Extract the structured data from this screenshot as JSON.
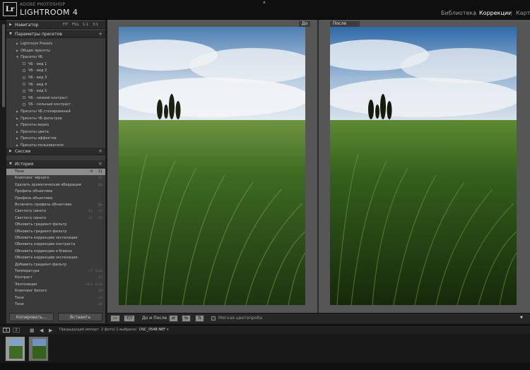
{
  "brand": {
    "logo": "Lr",
    "sub": "ADOBE PHOTOSHOP",
    "main": "LIGHTROOM 4"
  },
  "modules": [
    "Библиотека",
    "Коррекции",
    "Карта"
  ],
  "active_module": "Коррекции",
  "navigator": {
    "title": "Навигатор",
    "zoom": [
      "FIT",
      "FILL",
      "1:1",
      "3:1"
    ]
  },
  "presets": {
    "title": "Параметры пресетов",
    "items": [
      {
        "label": "Lightroom Presets",
        "level": 1,
        "kind": "folder"
      },
      {
        "label": "Общие пресеты",
        "level": 1,
        "kind": "folder"
      },
      {
        "label": "Пресеты ЧБ",
        "level": 1,
        "kind": "open"
      },
      {
        "label": "ЧБ - вид 1",
        "level": 2,
        "kind": "preset"
      },
      {
        "label": "ЧБ - вид 2",
        "level": 2,
        "kind": "preset"
      },
      {
        "label": "ЧБ - вид 3",
        "level": 2,
        "kind": "preset"
      },
      {
        "label": "ЧБ - вид 4",
        "level": 2,
        "kind": "preset"
      },
      {
        "label": "ЧБ - вид 5",
        "level": 2,
        "kind": "preset"
      },
      {
        "label": "ЧБ - низкий контраст",
        "level": 2,
        "kind": "preset"
      },
      {
        "label": "ЧБ - сильный контраст",
        "level": 2,
        "kind": "preset"
      },
      {
        "label": "Пресеты ЧБ стонированый",
        "level": 1,
        "kind": "folder"
      },
      {
        "label": "Пресеты ЧБ фильтров",
        "level": 1,
        "kind": "folder"
      },
      {
        "label": "Пресеты видео",
        "level": 1,
        "kind": "folder"
      },
      {
        "label": "Пресеты цвета",
        "level": 1,
        "kind": "folder"
      },
      {
        "label": "Пресеты эффектов",
        "level": 1,
        "kind": "folder"
      },
      {
        "label": "Пресеты пользователя",
        "level": 1,
        "kind": "folder"
      }
    ]
  },
  "sessions": {
    "title": "Сессии"
  },
  "history": {
    "title": "История",
    "items": [
      {
        "label": "Тени",
        "v1": "-9",
        "v2": "11",
        "selected": true
      },
      {
        "label": "Клиппинг чёрного",
        "v1": "",
        "v2": "-15"
      },
      {
        "label": "Удалить хроматические аберрации",
        "v1": "",
        "v2": "Да"
      },
      {
        "label": "Профиль объектива",
        "v1": "",
        "v2": ""
      },
      {
        "label": "Профиль объектива",
        "v1": "",
        "v2": ""
      },
      {
        "label": "Включить профиль объектива",
        "v1": "",
        "v2": "Да"
      },
      {
        "label": "Светлоту синего",
        "v1": "-12",
        "v2": "-22"
      },
      {
        "label": "Светлоту синего",
        "v1": "-15",
        "v2": "-27"
      },
      {
        "label": "Обновить градиент-фильтр",
        "v1": "",
        "v2": ""
      },
      {
        "label": "Обновить градиент-фильтр",
        "v1": "",
        "v2": ""
      },
      {
        "label": "Обновить коррекцию экспозиции",
        "v1": "",
        "v2": ""
      },
      {
        "label": "Обновить коррекцию контраста",
        "v1": "",
        "v2": ""
      },
      {
        "label": "Обновить коррекцию в бликах",
        "v1": "",
        "v2": ""
      },
      {
        "label": "Обновить коррекцию экспозиции",
        "v1": "",
        "v2": ""
      },
      {
        "label": "Добавить градиент-фильтр",
        "v1": "",
        "v2": ""
      },
      {
        "label": "Температура",
        "v1": "+7",
        "v2": "5.6K"
      },
      {
        "label": "Контраст",
        "v1": "",
        "v2": "15"
      },
      {
        "label": "Экспозиция",
        "v1": "+0.2",
        "v2": "0.34"
      },
      {
        "label": "Клиппинг белого",
        "v1": "",
        "v2": "20"
      },
      {
        "label": "Тени",
        "v1": "",
        "v2": "-20"
      },
      {
        "label": "Тени",
        "v1": "",
        "v2": "-20"
      }
    ]
  },
  "buttons": {
    "copy": "Копировать...",
    "paste": "Вставить"
  },
  "view": {
    "before": "До",
    "after": "После"
  },
  "toolbar": {
    "yy": "Y|Y",
    "before_after": "До и После :",
    "soft_proof": "Мягкая цветопроба"
  },
  "filmstrip": {
    "pages": [
      "1",
      "2"
    ],
    "source": "Предыдущий импорт",
    "count": "2 фото/ 1 выбрано/",
    "filename": "DSC_0548.NEF"
  }
}
